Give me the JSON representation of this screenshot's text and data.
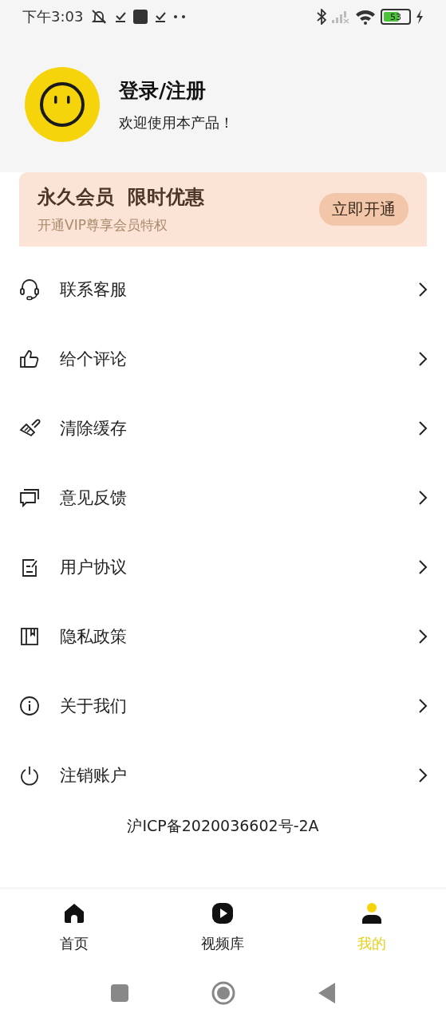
{
  "status_bar": {
    "time": "下午3:03",
    "battery": "53"
  },
  "profile": {
    "title": "登录/注册",
    "subtitle": "欢迎使用本产品！"
  },
  "vip_banner": {
    "title": "永久会员  限时优惠",
    "subtitle": "开通VIP尊享会员特权",
    "button": "立即开通"
  },
  "menu": [
    {
      "label": "联系客服"
    },
    {
      "label": "给个评论"
    },
    {
      "label": "清除缓存"
    },
    {
      "label": "意见反馈"
    },
    {
      "label": "用户协议"
    },
    {
      "label": "隐私政策"
    },
    {
      "label": "关于我们"
    },
    {
      "label": "注销账户"
    }
  ],
  "footer": "沪ICP备2020036602号-2A",
  "tabs": [
    {
      "label": "首页",
      "selected": false
    },
    {
      "label": "视频库",
      "selected": false
    },
    {
      "label": "我的",
      "selected": true
    }
  ]
}
